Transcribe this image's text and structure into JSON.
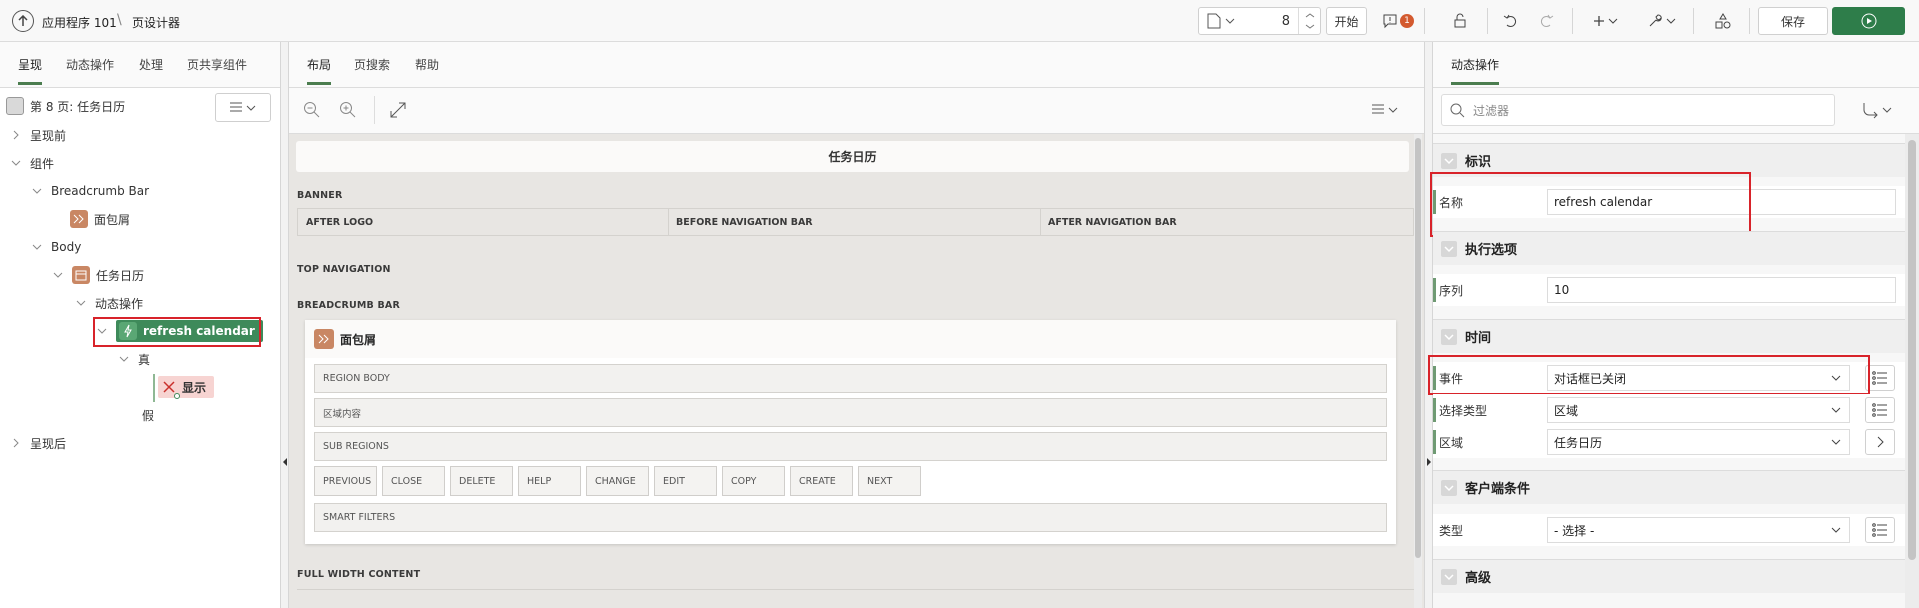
{
  "breadcrumb": {
    "app": "应用程序 101",
    "page": "页设计器"
  },
  "toolbar": {
    "page_number": "8",
    "start_label": "开始",
    "error_count": "1",
    "save_label": "保存"
  },
  "left": {
    "tabs": [
      "呈现",
      "动态操作",
      "处理",
      "页共享组件"
    ],
    "page_title": "第 8 页: 任务日历",
    "tree": {
      "before_render": "呈现前",
      "components": "组件",
      "breadcrumb_bar": "Breadcrumb Bar",
      "breadcrumb_item": "面包屑",
      "body": "Body",
      "calendar": "任务日历",
      "dynamic_actions": "动态操作",
      "da_name": "refresh calendar",
      "true_label": "真",
      "show_action": "显示",
      "false_label": "假",
      "after_render": "呈现后"
    }
  },
  "center": {
    "tabs": [
      "布局",
      "页搜索",
      "帮助"
    ],
    "page_title": "任务日历",
    "banner": "BANNER",
    "after_logo": "AFTER LOGO",
    "before_nav": "BEFORE NAVIGATION BAR",
    "after_nav": "AFTER NAVIGATION BAR",
    "top_nav": "TOP NAVIGATION",
    "breadcrumb_bar": "BREADCRUMB BAR",
    "region_title": "面包屑",
    "region_body": "REGION BODY",
    "region_content": "区域内容",
    "sub_regions": "SUB REGIONS",
    "buttons": [
      "PREVIOUS",
      "CLOSE",
      "DELETE",
      "HELP",
      "CHANGE",
      "EDIT",
      "COPY",
      "CREATE",
      "NEXT"
    ],
    "smart_filters": "SMART FILTERS",
    "full_width": "FULL WIDTH CONTENT"
  },
  "right": {
    "tab": "动态操作",
    "filter_placeholder": "过滤器",
    "sections": {
      "identity": "标识",
      "execution": "执行选项",
      "when": "时间",
      "client_condition": "客户端条件",
      "advanced": "高级"
    },
    "fields": {
      "name_label": "名称",
      "name_value": "refresh calendar",
      "sequence_label": "序列",
      "sequence_value": "10",
      "event_label": "事件",
      "event_value": "对话框已关闭",
      "selection_type_label": "选择类型",
      "selection_type_value": "区域",
      "region_label": "区域",
      "region_value": "任务日历",
      "type_label": "类型",
      "type_value": "- 选择 -"
    }
  },
  "colors": {
    "accent": "#4b7d4f",
    "primary": "#2e7d4a",
    "da_node": "#3e8a5a",
    "highlight": "#d8232a",
    "region_icon": "#c98764"
  }
}
